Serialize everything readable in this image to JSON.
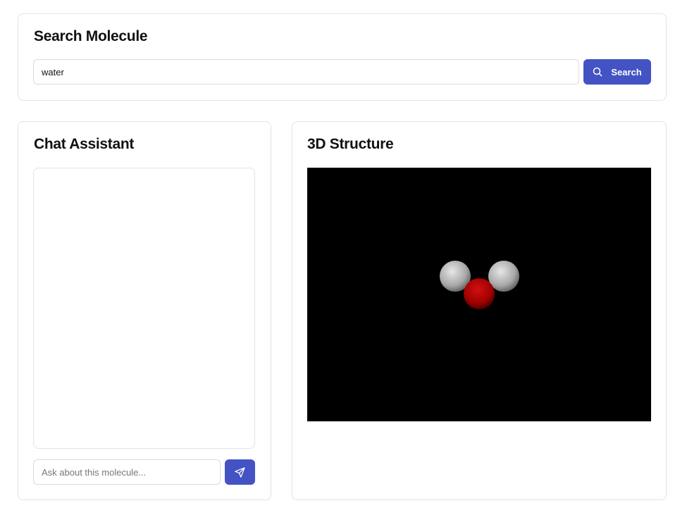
{
  "search": {
    "title": "Search Molecule",
    "value": "water",
    "button_label": "Search"
  },
  "chat": {
    "title": "Chat Assistant",
    "placeholder": "Ask about this molecule..."
  },
  "viewer": {
    "title": "3D Structure",
    "molecule": "water",
    "colors": {
      "oxygen": "#b00000",
      "hydrogen": "#cfcfcf",
      "background": "#000000"
    }
  },
  "colors": {
    "accent": "#4353c4"
  }
}
